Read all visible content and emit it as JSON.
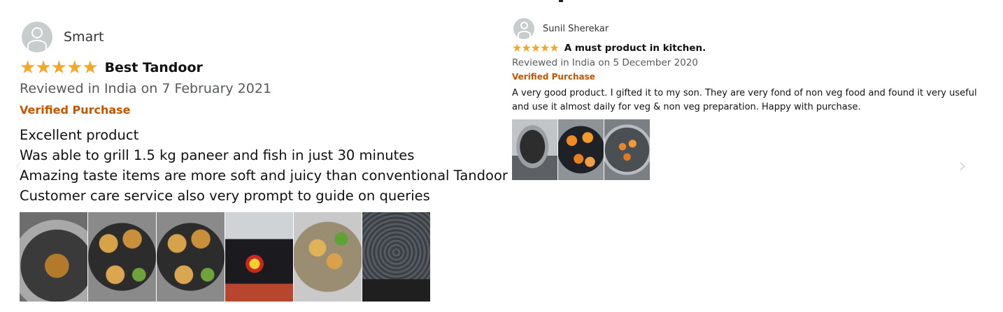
{
  "reviews": [
    {
      "reviewer": "Smart",
      "rating": 5,
      "stars": [
        "★",
        "★",
        "★",
        "★",
        "★"
      ],
      "title": "Best Tandoor",
      "meta": "Reviewed in India on 7 February 2021",
      "verified": "Verified Purchase",
      "body": [
        "Excellent product",
        "Was able to grill 1.5 kg paneer and fish in just 30 minutes",
        "Amazing taste items are more soft and juicy than conventional Tandoor",
        "Customer care service also very prompt to guide on queries"
      ],
      "photo_count": 6
    },
    {
      "reviewer": "Sunil Sherekar",
      "rating": 5,
      "stars": [
        "★",
        "★",
        "★",
        "★",
        "★"
      ],
      "title": "A must product in kitchen.",
      "meta": "Reviewed in India on 5 December 2020",
      "verified": "Verified Purchase",
      "body": "A very good product. I gifted it to my son. They are very fond of non veg food and found it very useful and use it almost daily for veg & non veg preparation. Happy with purchase.",
      "photo_count": 3
    }
  ],
  "carousel": {
    "next_icon": "chevron-right-icon",
    "prev_icon": "chevron-left-icon",
    "next_glyph": "›",
    "prev_glyph": "‹"
  },
  "colors": {
    "star": "#f5a623",
    "verified": "#c45500",
    "meta": "#565959",
    "text": "#0f1111"
  }
}
